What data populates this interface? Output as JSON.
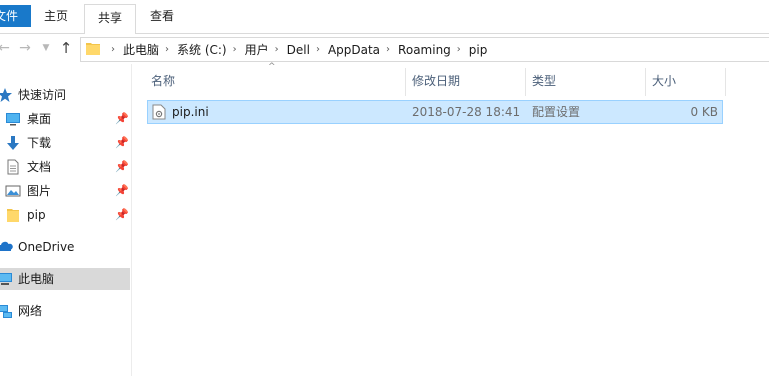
{
  "ribbon": {
    "file_tab": "文件",
    "home_tab": "主页",
    "share_tab": "共享",
    "view_tab": "查看"
  },
  "address": {
    "segments": [
      "此电脑",
      "系统 (C:)",
      "用户",
      "Dell",
      "AppData",
      "Roaming",
      "pip"
    ]
  },
  "sidebar": {
    "quick_access": "快速访问",
    "items": [
      {
        "label": "桌面",
        "icon": "desktop-icon"
      },
      {
        "label": "下载",
        "icon": "download-icon"
      },
      {
        "label": "文档",
        "icon": "document-icon"
      },
      {
        "label": "图片",
        "icon": "pictures-icon"
      },
      {
        "label": "pip",
        "icon": "folder-icon"
      }
    ],
    "onedrive": "OneDrive",
    "this_pc": "此电脑",
    "network": "网络"
  },
  "columns": {
    "name": "名称",
    "modified": "修改日期",
    "type": "类型",
    "size": "大小"
  },
  "files": [
    {
      "name": "pip.ini",
      "modified": "2018-07-28 18:41",
      "type": "配置设置",
      "size": "0 KB"
    }
  ],
  "colors": {
    "accent": "#1979ca",
    "selection_bg": "#cce8ff",
    "selection_border": "#99d1ff",
    "folder": "#f3c54b"
  }
}
